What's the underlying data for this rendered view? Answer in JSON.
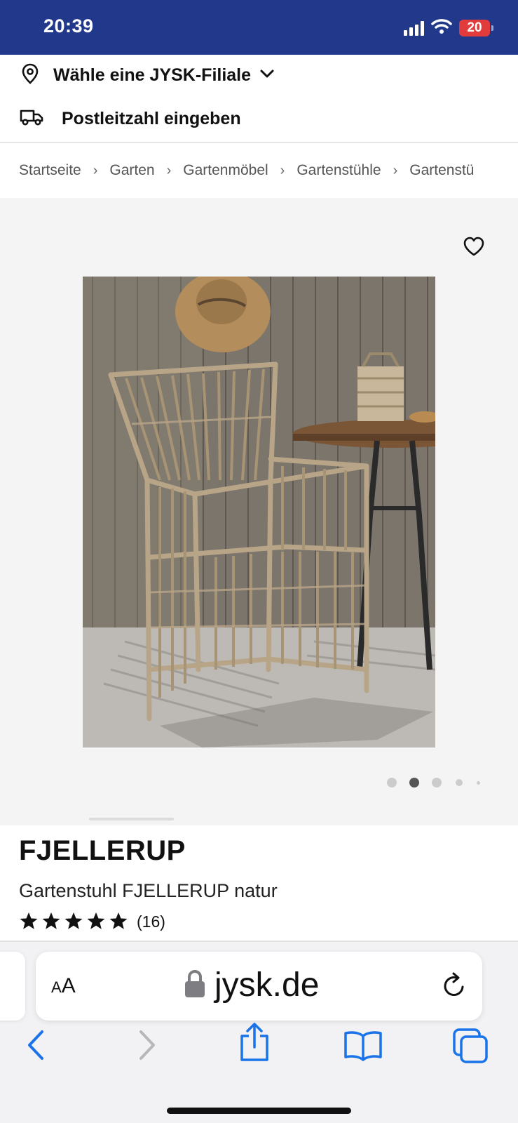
{
  "status_bar": {
    "time": "20:39",
    "battery": "20",
    "bg_color": "#22388a",
    "icons": [
      "signal-icon",
      "wifi-icon",
      "battery-icon"
    ]
  },
  "store": {
    "select_label": "Wähle eine JYSK-Filiale",
    "zip_label": "Postleitzahl eingeben"
  },
  "breadcrumb": {
    "items": [
      "Startseite",
      "Garten",
      "Gartenmöbel",
      "Gartenstühle",
      "Gartenstü"
    ]
  },
  "gallery": {
    "image_alt": "Gartenstuhl FJELLERUP natur",
    "slides_total": 5,
    "active_slide": 2
  },
  "product": {
    "name": "FJELLERUP",
    "subtitle": "Gartenstuhl FJELLERUP natur",
    "rating": 5,
    "review_count": "(16)"
  },
  "browser": {
    "text_size_label_big": "A",
    "text_size_label_small": "A",
    "url": "jysk.de",
    "accent_color": "#1a73e8"
  }
}
